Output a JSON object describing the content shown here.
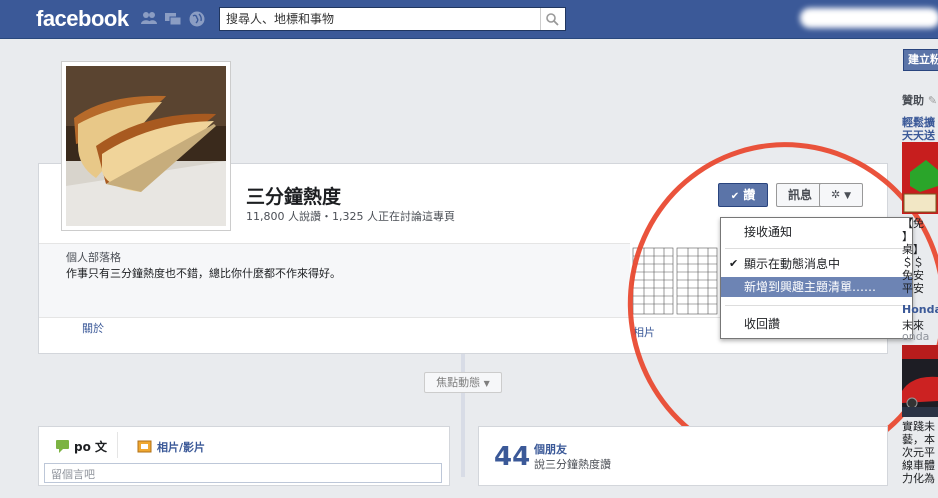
{
  "header": {
    "logo": "facebook",
    "search_placeholder": "搜尋人、地標和事物",
    "icons": [
      "friend-requests-icon",
      "messages-icon",
      "notifications-globe-icon",
      "search-icon"
    ]
  },
  "page": {
    "title": "三分鐘熱度",
    "stats": "11,800 人說讚・1,325 人正在討論這專頁",
    "category": "個人部落格",
    "description": "作事只有三分鐘熱度也不錯，總比你什麼都不作來得好。",
    "tab_about": "關於",
    "tab_photos": "相片"
  },
  "buttons": {
    "like": "讚",
    "message": "訊息",
    "gear": "✲"
  },
  "like_menu": {
    "items": [
      "接收通知",
      "顯示在動態消息中",
      "新增到興趣主題清單……",
      "收回讚"
    ],
    "checked_index": 1,
    "selected_index": 2
  },
  "timeline": {
    "focus_label": "焦點動態"
  },
  "composer": {
    "post_label": "po 文",
    "photo_label": "相片/影片",
    "placeholder": "留個言吧"
  },
  "friends_box": {
    "count": "44",
    "label": "個朋友",
    "sub": "說三分鐘熱度讚"
  },
  "right_column": {
    "create_button": "建立粉",
    "sponsored": "贊助",
    "ad_title_line1": "輕鬆擴",
    "ad_title_line2": "天天送",
    "ad_lines": [
      "【免",
      "】",
      "桌】",
      "＄＄",
      "免安",
      "平安"
    ],
    "ad2_title": "Honda",
    "ad2_lines": [
      "末來",
      "onda"
    ],
    "ad3_lines": [
      "實踐未",
      "藝，本",
      "次元平",
      "線車體",
      "力化為"
    ]
  },
  "colors": {
    "brand": "#3b5998",
    "highlight": "#6d84b4",
    "annotation_ring": "#e8462d"
  }
}
